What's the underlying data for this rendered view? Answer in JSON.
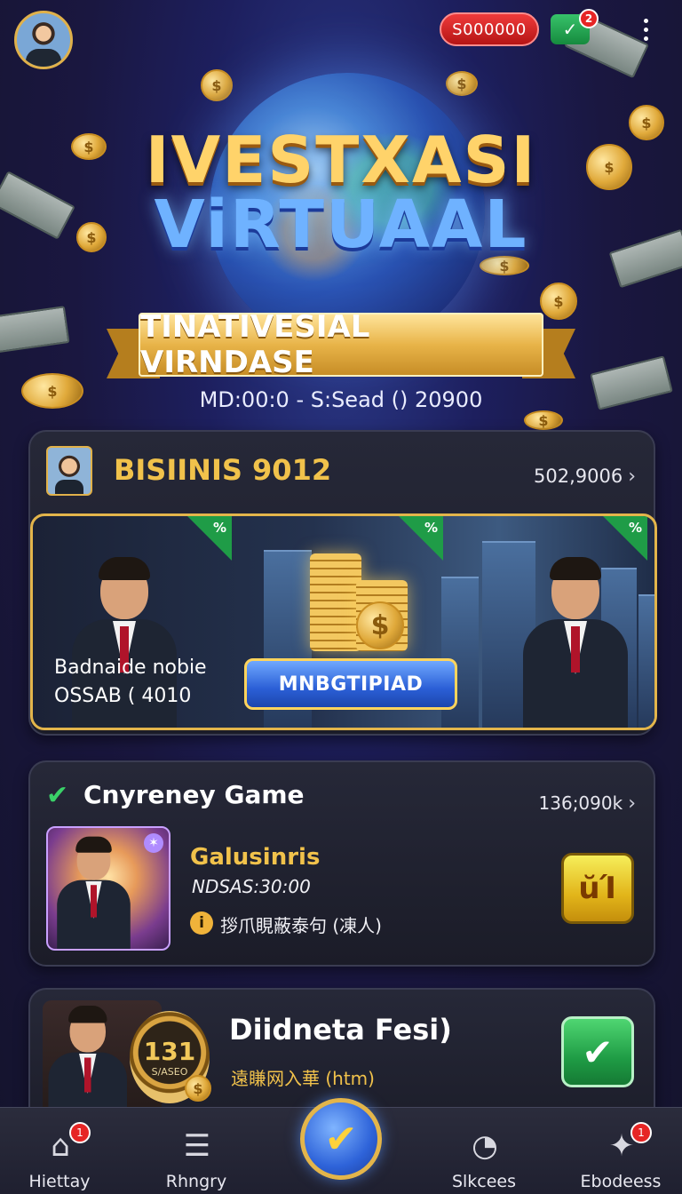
{
  "topbar": {
    "coins": "S000000",
    "notification_badge": "2",
    "notification_icon": "money-check-icon",
    "menu_icon": "kebab-menu-icon"
  },
  "hero": {
    "title_line1": "IVESTXASI",
    "title_line2": "ViRTUAAL",
    "ribbon": "TINATIVESIAL VIRNDASE",
    "subtitle": "MD:00:0 - S:Sead () 20900"
  },
  "card_business": {
    "title": "BISIINIS 9012",
    "meta": "502,9006",
    "banner_line1": "Badnaide nobie",
    "banner_line2": "OSSAB ( 4010",
    "cta": "MNBGTIPIAD",
    "tag_icon": "percent-icon"
  },
  "card_currency": {
    "title": "Cnyreney Game",
    "meta": "136;090k",
    "name": "Galusinris",
    "time": "NDSAS:30:00",
    "info": "拶爪睍蔽泰句 (凍人)",
    "action": "ŭΊ"
  },
  "card_dividend": {
    "title": "Diidneta Fesi)",
    "subtitle": "遠䁠网入華 (htm)",
    "medal_number": "131",
    "medal_caption": "S/ASEO"
  },
  "bottom_nav": {
    "items": [
      {
        "label": "Hiettay",
        "icon": "home-icon",
        "badge": "1"
      },
      {
        "label": "Rhngry",
        "icon": "document-icon",
        "badge": ""
      },
      {
        "label": "Slkcees",
        "icon": "chart-icon",
        "badge": ""
      },
      {
        "label": "Ebodeess",
        "icon": "gamepad-icon",
        "badge": "1"
      }
    ],
    "center_icon": "check-icon"
  },
  "colors": {
    "gold": "#f1c24b",
    "accent_blue": "#2e63d9",
    "success_green": "#1f9c45",
    "alert_red": "#e62525"
  }
}
